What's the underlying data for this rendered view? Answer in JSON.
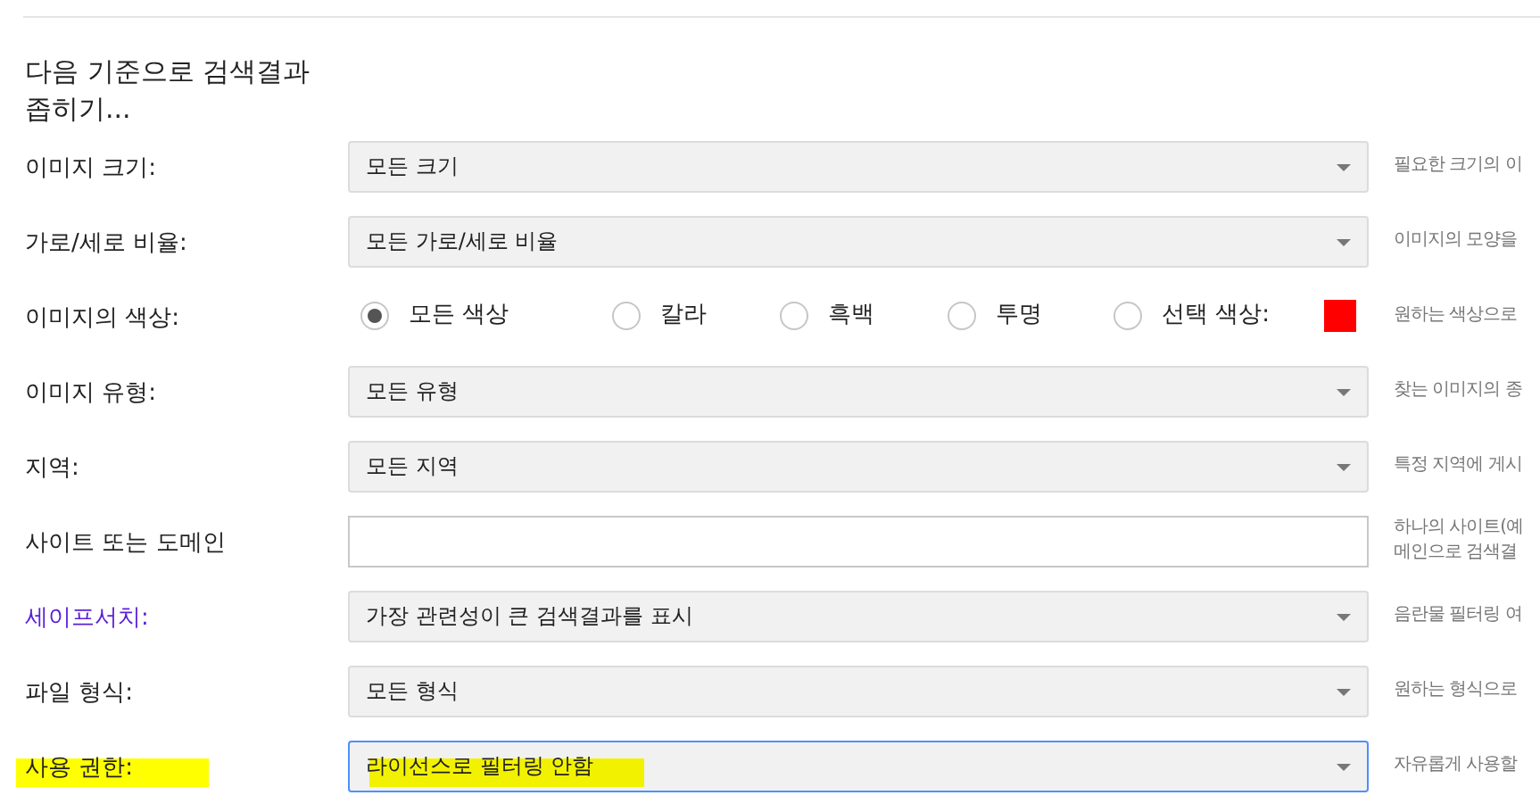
{
  "heading": "다음 기준으로 검색결과 좁히기...",
  "rows": [
    {
      "label": "이미지 크기:",
      "link": false,
      "kind": "select",
      "value": "모든 크기",
      "focused": false,
      "highlighted": false,
      "hint": "필요한 크기의 이"
    },
    {
      "label": "가로/세로 비율:",
      "link": false,
      "kind": "select",
      "value": "모든 가로/세로 비율",
      "focused": false,
      "highlighted": false,
      "hint": "이미지의 모양을"
    },
    {
      "label": "이미지의 색상:",
      "link": false,
      "kind": "radio",
      "options": [
        {
          "label": "모든 색상",
          "selected": true
        },
        {
          "label": "칼라",
          "selected": false
        },
        {
          "label": "흑백",
          "selected": false
        },
        {
          "label": "투명",
          "selected": false
        },
        {
          "label": "선택 색상:",
          "selected": false
        }
      ],
      "color": "#ff0000",
      "highlighted": false,
      "hint": "원하는 색상으로"
    },
    {
      "label": "이미지 유형:",
      "link": false,
      "kind": "select",
      "value": "모든 유형",
      "focused": false,
      "highlighted": false,
      "hint": "찾는 이미지의 종"
    },
    {
      "label": "지역:",
      "link": false,
      "kind": "select",
      "value": "모든 지역",
      "focused": false,
      "highlighted": false,
      "hint": "특정 지역에 게시"
    },
    {
      "label": "사이트 또는 도메인",
      "link": false,
      "kind": "input",
      "highlighted": false,
      "hint": "하나의 사이트(예\n메인으로 검색결"
    },
    {
      "label": "세이프서치:",
      "link": true,
      "kind": "select",
      "value": "가장 관련성이 큰 검색결과를 표시",
      "focused": false,
      "highlighted": false,
      "hint": "음란물 필터링 여"
    },
    {
      "label": "파일 형식:",
      "link": false,
      "kind": "select",
      "value": "모든 형식",
      "focused": false,
      "highlighted": false,
      "hint": "원하는 형식으로"
    },
    {
      "label": "사용 권한:",
      "link": false,
      "kind": "select",
      "value": "라이선스로 필터링 안함",
      "focused": true,
      "highlighted": true,
      "hint": "자유롭게 사용할"
    }
  ]
}
